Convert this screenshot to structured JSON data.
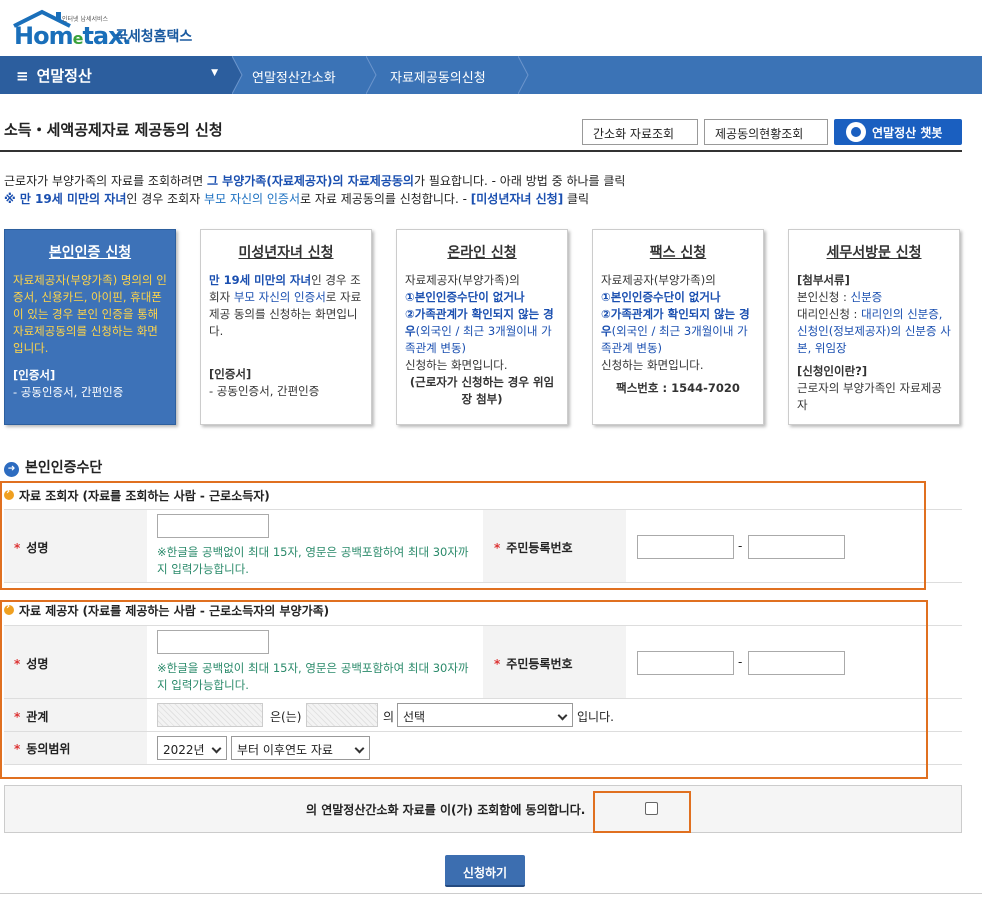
{
  "header": {
    "logo_sub": "인터넷 납세서비스",
    "logo_main_a": "Hom",
    "logo_main_e": "e",
    "logo_main_b": "tax.",
    "logo_kr": "국세청홈택스"
  },
  "nav": {
    "main": "연말정산",
    "items": [
      "연말정산간소화",
      "자료제공동의신청"
    ]
  },
  "page": {
    "title": "소득・세액공제자료 제공동의 신청",
    "buttons": [
      "간소화 자료조회",
      "제공동의현황조회"
    ],
    "chatbot": "연말정산 챗봇"
  },
  "intro": {
    "line1_a": "근로자가 부양가족의 자료를 조회하려면 ",
    "line1_b": "그 부양가족(자료제공자)의 자료제공동의",
    "line1_c": "가 필요합니다. - 아래 방법 중 하나를 클릭",
    "line2_a": "※ 만 19세 미만의 자녀",
    "line2_b": "인 경우 조회자 ",
    "line2_c": "부모 자신의 인증서",
    "line2_d": "로 자료 제공동의를 신청합니다. - ",
    "line2_e": "[미성년자녀 신청]",
    "line2_f": " 클릭"
  },
  "cards": [
    {
      "title": "본인인증 신청",
      "body": "자료제공자(부양가족) 명의의 인증서, 신용카드, 아이핀, 휴대폰이 있는 경우 본인 인증을 통해 자료제공동의를 신청하는 화면입니다.",
      "sec_title": "[인증서]",
      "sec_body": "- 공동인증서, 간편인증"
    },
    {
      "title": "미성년자녀 신청",
      "body_a": "만 19세 미만의 자녀",
      "body_b": "인 경우 조회자 ",
      "body_c": "부모 자신의 인증서",
      "body_d": "로 자료 제공 동의를 신청하는 화면입니다.",
      "sec_title": "[인증서]",
      "sec_body": "- 공동인증서, 간편인증"
    },
    {
      "title": "온라인 신청",
      "body_a": "자료제공자(부양가족)의",
      "body_b": "①본인인증수단이 없거나",
      "body_c": "②가족관계가 확인되지 않는 경우",
      "body_d": "(외국인 / 최근 3개월이내 가족관계 변동)",
      "body_e": "신청하는 화면입니다.",
      "body_f": "(근로자가 신청하는 경우 위임장 첨부)"
    },
    {
      "title": "팩스 신청",
      "body_a": "자료제공자(부양가족)의",
      "body_b": "①본인인증수단이 없거나",
      "body_c": "②가족관계가 확인되지 않는 경우",
      "body_d": "(외국인 / 최근 3개월이내 가족관계 변동)",
      "body_e": "신청하는 화면입니다.",
      "fax": "팩스번호 : 1544-7020"
    },
    {
      "title": "세무서방문 신청",
      "sec1": "[첨부서류]",
      "l1a": "본인신청 : ",
      "l1b": "신분증",
      "l2a": "대리인신청 : ",
      "l2b": "대리인의 신분증, 신청인(정보제공자)의 신분증 사본, 위임장",
      "sec2": "[신청인이란?]",
      "sec2_body": "근로자의 부양가족인 자료제공자"
    }
  ],
  "section": {
    "title": "본인인증수단",
    "viewer_title": "자료 조회자 (자료를 조회하는 사람 - 근로소득자)",
    "provider_title": "자료 제공자 (자료를 제공하는 사람 - 근로소득자의 부양가족)",
    "name_label": "성명",
    "rrn_label": "주민등록번호",
    "name_note": "※한글을 공백없이 최대 15자, 영문은 공백포함하여 최대 30자까지 입력가능합니다.",
    "dash": "-",
    "relation_label": "관계",
    "relation_eun": "은(는)",
    "relation_ui": "의",
    "relation_select": "선택",
    "relation_end": "입니다.",
    "scope_label": "동의범위",
    "year_select": "2022년",
    "scope_select": "부터 이후연도 자료"
  },
  "agree": {
    "text": "의 연말정산간소화 자료를 이(가) 조회함에 동의합니다."
  },
  "submit": "신청하기",
  "colors": {
    "nav": "#3b73b6",
    "nav_main": "#2c5e9e",
    "highlight": "#e07020",
    "active_card": "#3d72b8"
  }
}
